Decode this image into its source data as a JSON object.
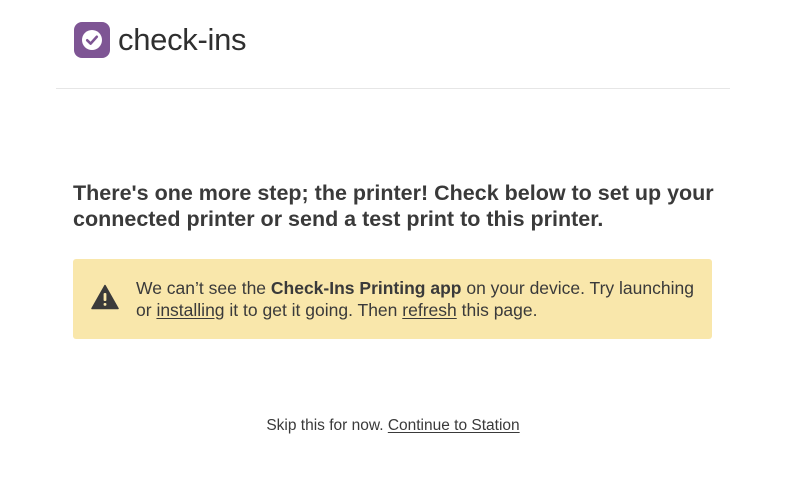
{
  "header": {
    "logo_text": "check-ins",
    "logo_icon": "checkmark-icon",
    "logo_color": "#7e5594"
  },
  "main": {
    "heading": "There's one more step; the printer! Check below to set up your connected printer or send a test print to this printer."
  },
  "alert": {
    "icon": "warning-icon",
    "background": "#f9e7ab",
    "text_1": "We can’t see the ",
    "app_name": "Check-Ins Printing app",
    "text_2": " on your device. Try launching or ",
    "installing_link": "installing",
    "text_3": " it to get it going. Then ",
    "refresh_link": "refresh",
    "text_4": " this page."
  },
  "footer": {
    "skip_text": "Skip this for now. ",
    "continue_link": "Continue to Station"
  }
}
